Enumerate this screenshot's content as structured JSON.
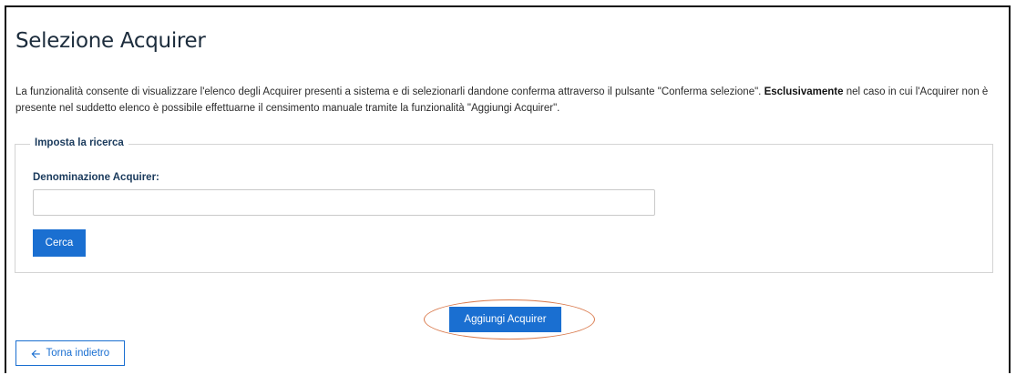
{
  "page": {
    "title": "Selezione Acquirer",
    "description_part1": "La funzionalità consente di visualizzare l'elenco degli Acquirer presenti a sistema e di selezionarli dandone conferma attraverso il pulsante \"Conferma selezione\". ",
    "description_bold": "Esclusivamente",
    "description_part2": " nel caso in cui l'Acquirer non è presente nel suddetto elenco è possibile effettuarne il censimento manuale tramite la funzionalità \"Aggiungi Acquirer\"."
  },
  "search": {
    "legend": "Imposta la ricerca",
    "field_label": "Denominazione Acquirer:",
    "input_value": "",
    "search_button_label": "Cerca"
  },
  "actions": {
    "add_acquirer_label": "Aggiungi Acquirer",
    "back_label": "Torna indietro",
    "back_icon": "arrow-left-icon"
  },
  "colors": {
    "primary": "#1a6fd1",
    "heading": "#1a3a5c",
    "highlight": "#d9784a"
  }
}
